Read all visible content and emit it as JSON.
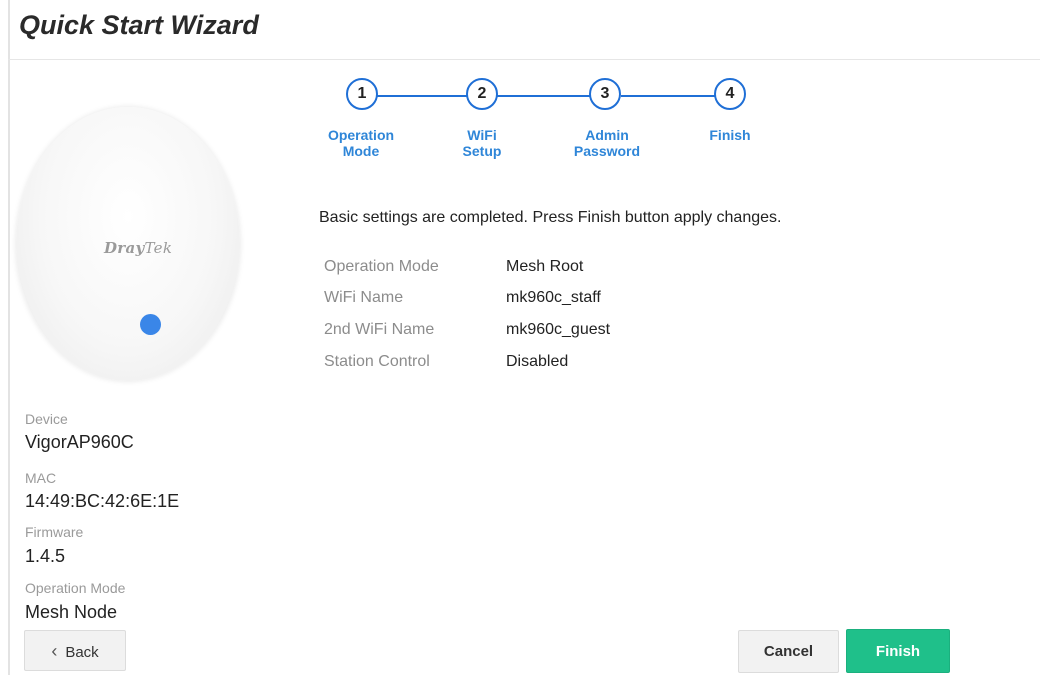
{
  "header": {
    "title": "Quick Start Wizard"
  },
  "device_panel": {
    "brand_logo": "DrayTek",
    "info": [
      {
        "label": "Device",
        "value": "VigorAP960C"
      },
      {
        "label": "MAC",
        "value": "14:49:BC:42:6E:1E"
      },
      {
        "label": "Firmware",
        "value": "1.4.5"
      },
      {
        "label": "Operation Mode",
        "value": "Mesh Node"
      }
    ]
  },
  "steps": [
    {
      "number": "1",
      "line1": "Operation",
      "line2": "Mode"
    },
    {
      "number": "2",
      "line1": "WiFi",
      "line2": "Setup"
    },
    {
      "number": "3",
      "line1": "Admin",
      "line2": "Password"
    },
    {
      "number": "4",
      "line1": "Finish",
      "line2": ""
    }
  ],
  "summary": {
    "message": "Basic settings are completed. Press Finish button apply changes.",
    "rows": [
      {
        "label": "Operation Mode",
        "value": "Mesh Root"
      },
      {
        "label": "WiFi Name",
        "value": "mk960c_staff"
      },
      {
        "label": "2nd WiFi Name",
        "value": "mk960c_guest"
      },
      {
        "label": "Station Control",
        "value": "Disabled"
      }
    ]
  },
  "footer": {
    "back_label": "Back",
    "cancel_label": "Cancel",
    "finish_label": "Finish"
  },
  "colors": {
    "accent": "#1f6fd6",
    "step_label": "#2f86d8",
    "finish_button": "#1fc08a",
    "led": "#3a86e8"
  },
  "icons": {
    "back": "chevron-left-icon"
  }
}
